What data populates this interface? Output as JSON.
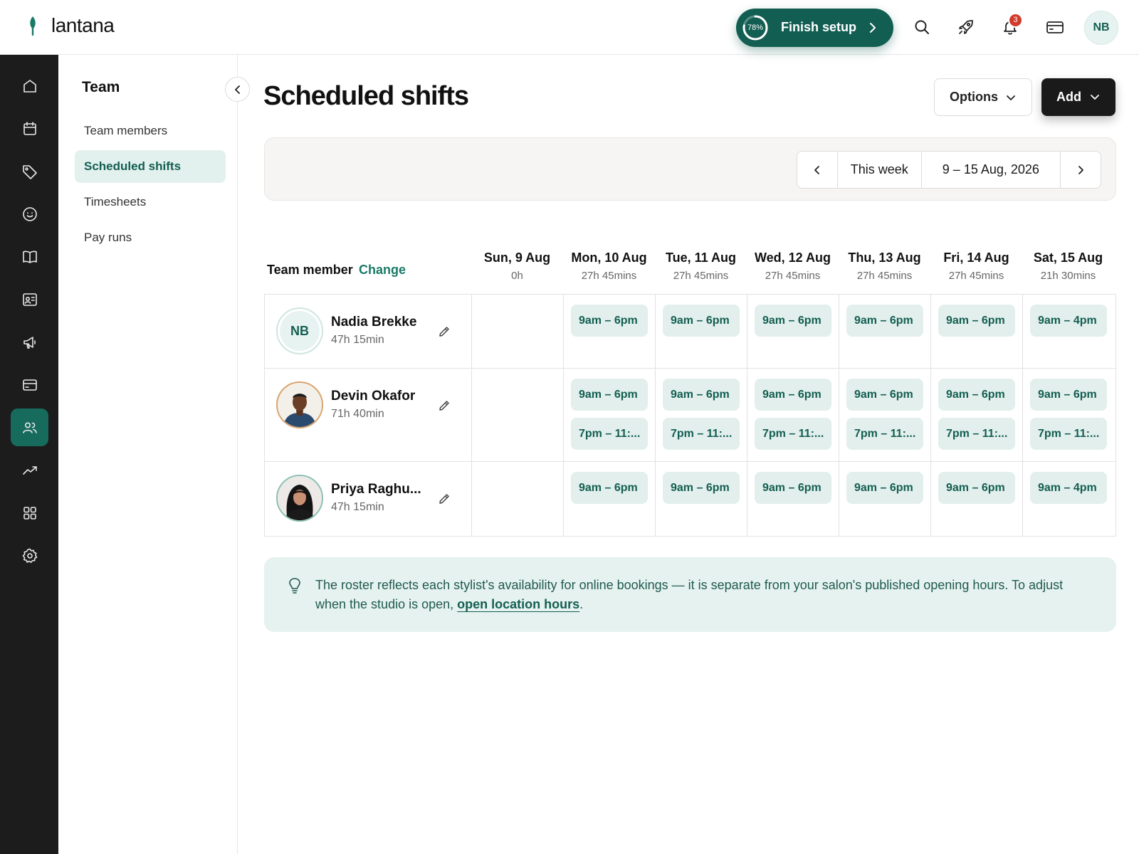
{
  "app": {
    "name": "lantana",
    "accent": "#135e52",
    "accent_light": "#e2efec"
  },
  "topbar": {
    "setup": {
      "progress_label": "78%",
      "progress": 0.78,
      "label": "Finish setup"
    },
    "icons": [
      "search-icon",
      "rocket-icon",
      "bell-icon",
      "card-icon"
    ],
    "notifications_count": "3",
    "user_initials": "NB"
  },
  "rail": {
    "items": [
      "home-icon",
      "calendar-icon",
      "tag-icon",
      "smile-icon",
      "book-icon",
      "contact-card-icon",
      "megaphone-icon",
      "card-icon",
      "team-icon",
      "trend-icon",
      "grid-icon",
      "gear-icon"
    ],
    "active": "team-icon"
  },
  "subnav": {
    "title": "Team",
    "items": [
      {
        "label": "Team members"
      },
      {
        "label": "Scheduled shifts"
      },
      {
        "label": "Timesheets"
      },
      {
        "label": "Pay runs"
      }
    ],
    "active_index": 1
  },
  "main": {
    "title": "Scheduled shifts",
    "options_label": "Options",
    "add_label": "Add",
    "week_nav": {
      "this_week": "This week",
      "range": "9 – 15 Aug, 2026"
    }
  },
  "schedule": {
    "member_header": "Team member",
    "change_label": "Change",
    "days": [
      {
        "name": "Sun, 9 Aug",
        "hours": "0h"
      },
      {
        "name": "Mon, 10 Aug",
        "hours": "27h 45mins"
      },
      {
        "name": "Tue, 11 Aug",
        "hours": "27h 45mins"
      },
      {
        "name": "Wed, 12 Aug",
        "hours": "27h 45mins"
      },
      {
        "name": "Thu, 13 Aug",
        "hours": "27h 45mins"
      },
      {
        "name": "Fri, 14 Aug",
        "hours": "27h 45mins"
      },
      {
        "name": "Sat, 15 Aug",
        "hours": "21h 30mins"
      }
    ],
    "members": [
      {
        "name": "Nadia Brekke",
        "hours": "47h 15min",
        "initials": "NB",
        "shifts": [
          [],
          [
            "9am – 6pm"
          ],
          [
            "9am – 6pm"
          ],
          [
            "9am – 6pm"
          ],
          [
            "9am – 6pm"
          ],
          [
            "9am – 6pm"
          ],
          [
            "9am – 4pm"
          ]
        ]
      },
      {
        "name": "Devin Okafor",
        "hours": "71h 40min",
        "shifts": [
          [],
          [
            "9am – 6pm",
            "7pm – 11:..."
          ],
          [
            "9am – 6pm",
            "7pm – 11:..."
          ],
          [
            "9am – 6pm",
            "7pm – 11:..."
          ],
          [
            "9am – 6pm",
            "7pm – 11:..."
          ],
          [
            "9am – 6pm",
            "7pm – 11:..."
          ],
          [
            "9am – 6pm",
            "7pm – 11:..."
          ]
        ]
      },
      {
        "name": "Priya Raghu...",
        "hours": "47h 15min",
        "shifts": [
          [],
          [
            "9am – 6pm"
          ],
          [
            "9am – 6pm"
          ],
          [
            "9am – 6pm"
          ],
          [
            "9am – 6pm"
          ],
          [
            "9am – 6pm"
          ],
          [
            "9am – 4pm"
          ]
        ]
      }
    ]
  },
  "info": {
    "text": "The roster reflects each stylist's availability for online bookings — it is separate from your salon's published opening hours. To adjust when the studio is open, ",
    "link": "open location hours",
    "suffix": "."
  }
}
